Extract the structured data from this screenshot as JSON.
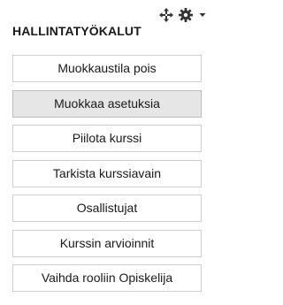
{
  "block": {
    "title": "HALLINTATYÖKALUT",
    "controls": {
      "move_icon": "move-icon",
      "settings_icon": "gear-icon",
      "menu_icon": "caret-down-icon"
    },
    "buttons": [
      {
        "label": "Muokkaustila pois",
        "active": false
      },
      {
        "label": "Muokkaa asetuksia",
        "active": true
      },
      {
        "label": "Piilota kurssi",
        "active": false
      },
      {
        "label": "Tarkista kurssiavain",
        "active": false
      },
      {
        "label": "Osallistujat",
        "active": false
      },
      {
        "label": "Kurssin arvioinnit",
        "active": false
      },
      {
        "label": "Vaihda rooliin Opiskelija",
        "active": false
      }
    ]
  },
  "colors": {
    "border": "#cfcfcf",
    "active_background": "#e6e6e6",
    "text": "#1a1a1a"
  }
}
